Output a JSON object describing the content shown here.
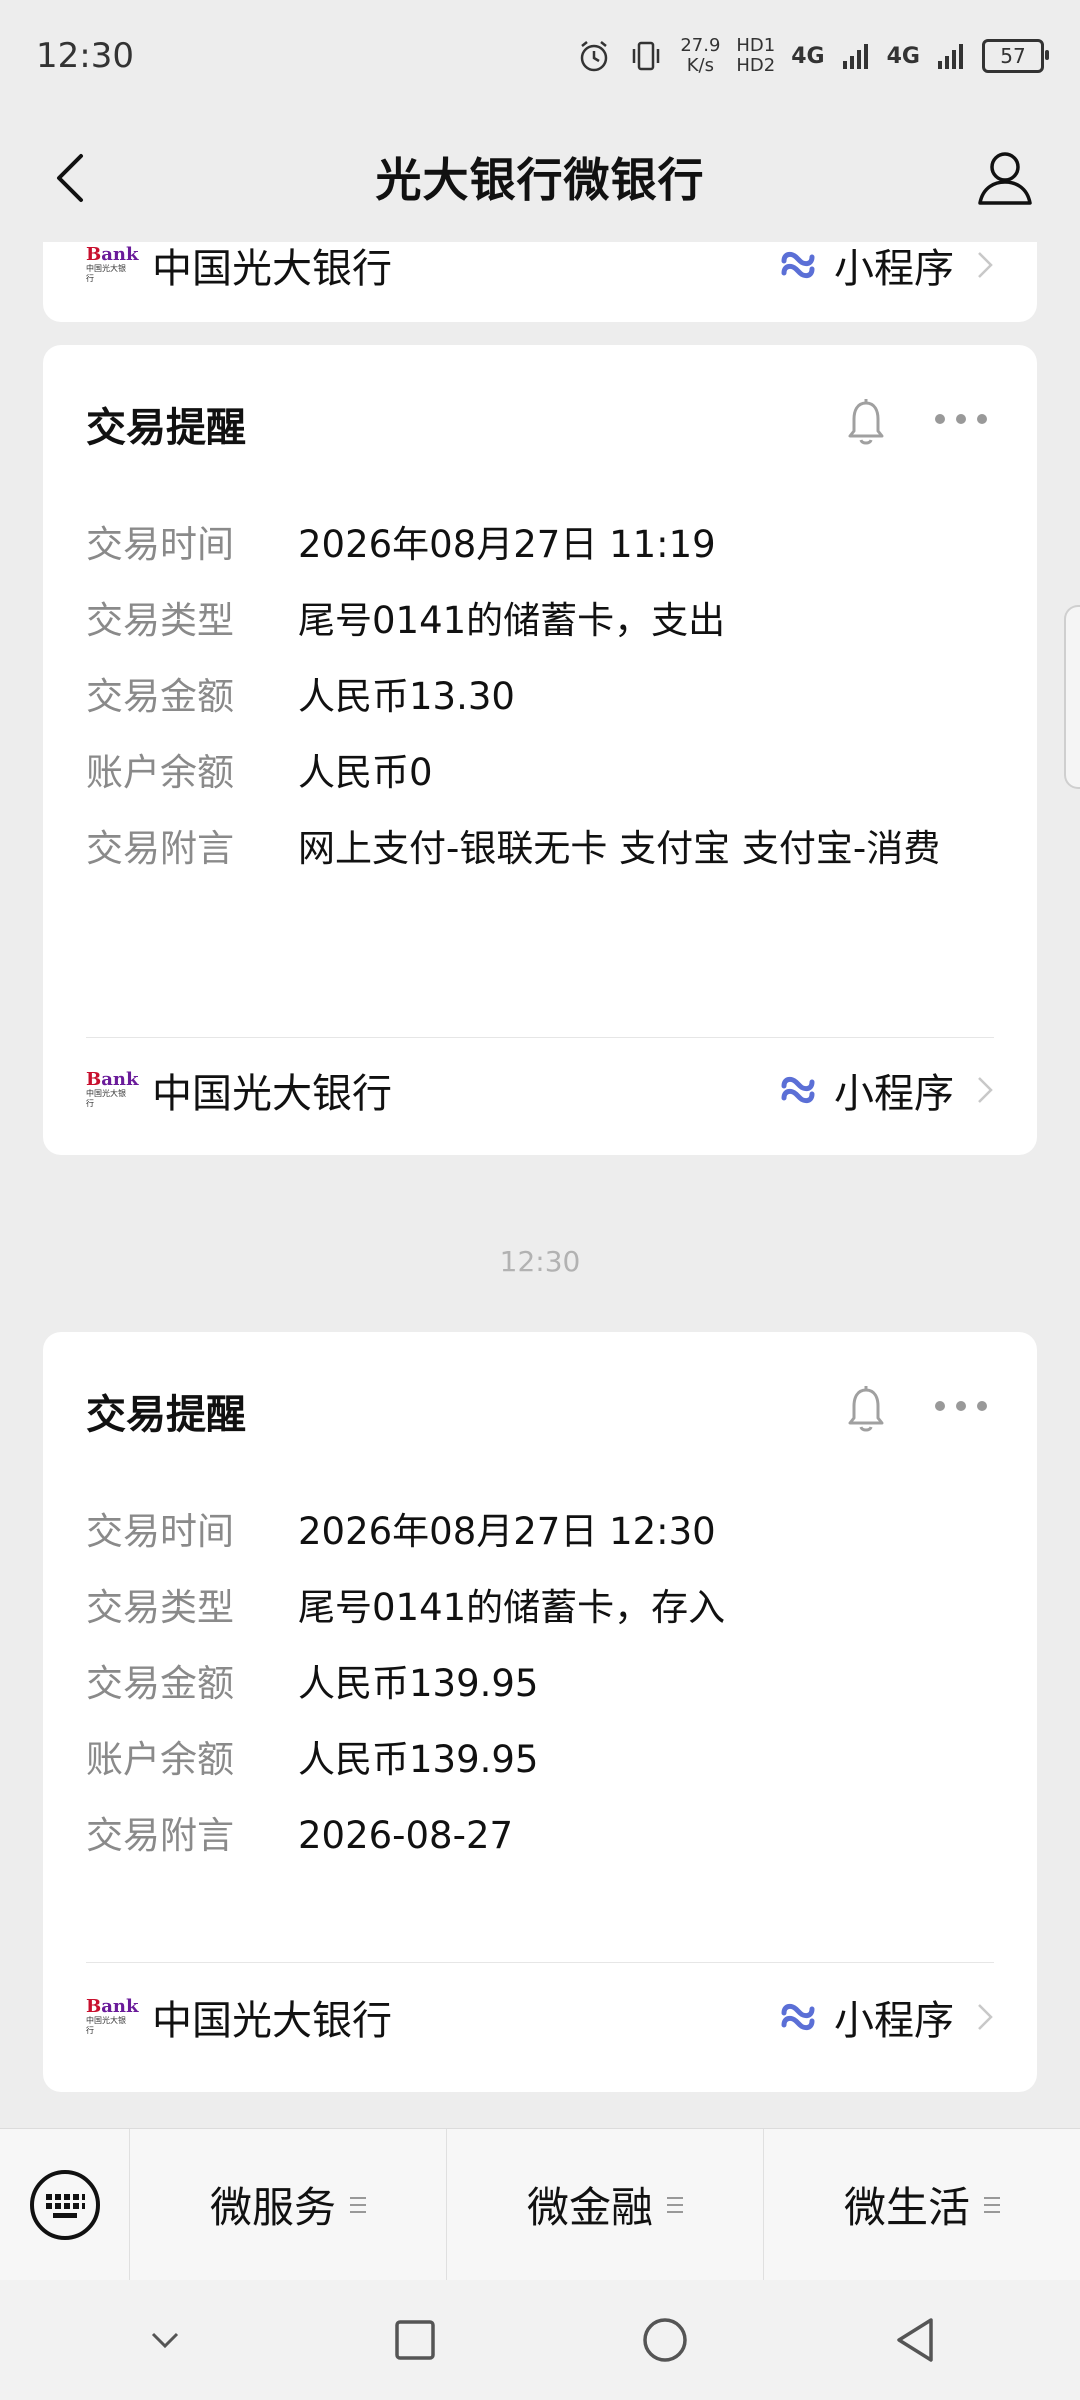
{
  "status_bar": {
    "time": "12:30",
    "speed_value": "27.9",
    "speed_unit": "K/s",
    "hd1": "HD1",
    "hd2": "HD2",
    "net1": "4G",
    "net2": "4G",
    "battery": "57"
  },
  "header": {
    "title": "光大银行微银行"
  },
  "top_partial_footer": {
    "bank_name": "中国光大银行",
    "mini_program": "小程序"
  },
  "cards": [
    {
      "heading": "交易提醒",
      "rows": [
        {
          "label": "交易时间",
          "value": "2026年08月27日 11:19"
        },
        {
          "label": "交易类型",
          "value": "尾号0141的储蓄卡，支出"
        },
        {
          "label": "交易金额",
          "value": "人民币13.30"
        },
        {
          "label": "账户余额",
          "value": "人民币0"
        },
        {
          "label": "交易附言",
          "value": "网上支付-银联无卡 支付宝 支付宝-消费"
        }
      ],
      "bank_name": "中国光大银行",
      "mini_program": "小程序"
    },
    {
      "heading": "交易提醒",
      "rows": [
        {
          "label": "交易时间",
          "value": "2026年08月27日 12:30"
        },
        {
          "label": "交易类型",
          "value": "尾号0141的储蓄卡，存入"
        },
        {
          "label": "交易金额",
          "value": "人民币139.95"
        },
        {
          "label": "账户余额",
          "value": "人民币139.95"
        },
        {
          "label": "交易附言",
          "value": "2026-08-27"
        }
      ],
      "bank_name": "中国光大银行",
      "mini_program": "小程序"
    }
  ],
  "time_separator": "12:30",
  "bank_logo": {
    "mark_b": "B",
    "mark_rest": "ank",
    "sub": "中国光大银行"
  },
  "menu": {
    "items": [
      "微服务",
      "微金融",
      "微生活"
    ]
  },
  "colors": {
    "background": "#ededed",
    "card": "#ffffff",
    "mini_program_icon": "#5b6fd6",
    "label": "#8a8a8a"
  }
}
